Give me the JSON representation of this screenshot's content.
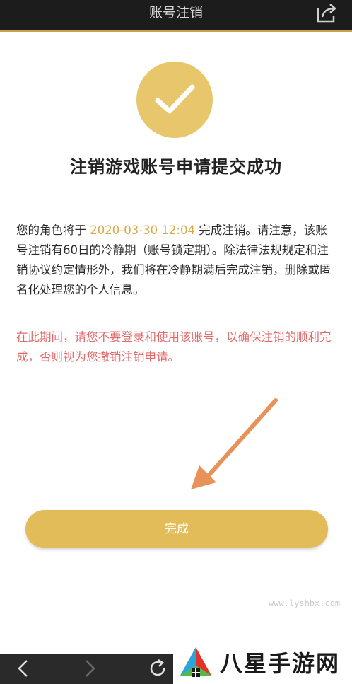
{
  "header": {
    "title": "账号注销"
  },
  "headline": "注销游戏账号申请提交成功",
  "notice": {
    "prefix": "您的角色将于",
    "date": "2020-03-30 12:04",
    "suffix": "完成注销。请注意，该账号注销有60日的冷静期（账号锁定期）。除法律法规规定和注销协议约定情形外，我们将在冷静期满后完成注销，删除或匿名化处理您的个人信息。"
  },
  "warning": "在此期间，请您不要登录和使用该账号，以确保注销的顺利完成，否则视为您撤销注销申请。",
  "done_button": "完成",
  "watermark": "www.lyshbx.com",
  "brand": {
    "name": "八星手游网"
  },
  "colors": {
    "accent": "#e8c66c",
    "warning": "#e06a6a",
    "date": "#d7a942",
    "arrow": "#e8925a"
  },
  "icons": {
    "share": "share-icon",
    "back": "back-arrow-icon",
    "forward": "forward-arrow-icon",
    "refresh": "refresh-icon",
    "success": "checkmark-icon"
  }
}
